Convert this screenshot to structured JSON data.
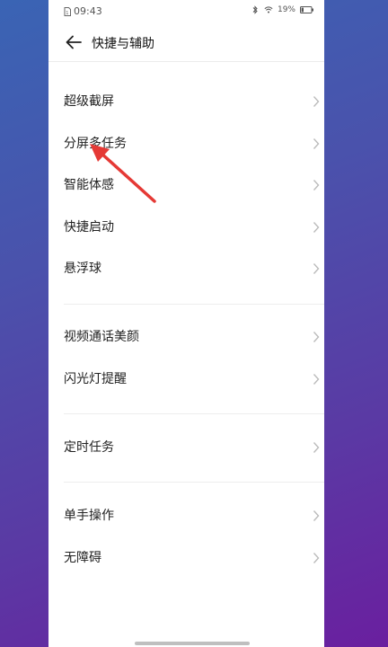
{
  "status_bar": {
    "time": "09:43",
    "battery": "19%"
  },
  "header": {
    "title": "快捷与辅助"
  },
  "groups": [
    {
      "items": [
        "超级截屏",
        "分屏多任务",
        "智能体感",
        "快捷启动",
        "悬浮球"
      ]
    },
    {
      "items": [
        "视频通话美颜",
        "闪光灯提醒"
      ]
    },
    {
      "items": [
        "定时任务"
      ]
    },
    {
      "items": [
        "单手操作",
        "无障碍"
      ]
    }
  ],
  "colors": {
    "annotation_arrow": "#e53935",
    "background_start": "#3a64b4",
    "background_end": "#6a1f9f"
  },
  "icons": [
    "sim-icon",
    "bluetooth-icon",
    "wifi-icon",
    "battery-icon",
    "back-arrow-icon",
    "chevron-right-icon"
  ]
}
